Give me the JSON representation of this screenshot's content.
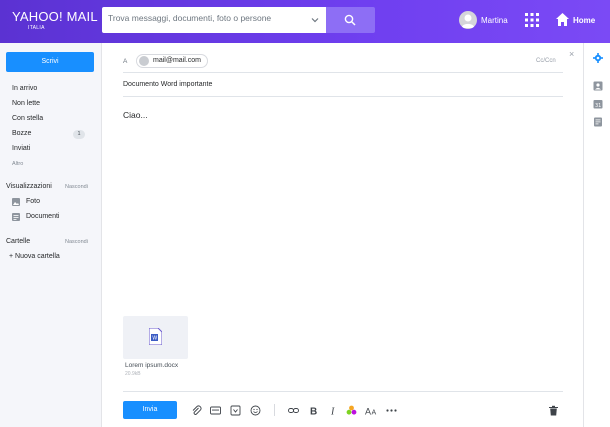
{
  "header": {
    "logo_main": "YAHOO! MAIL",
    "logo_sub": "ITALIA",
    "search_placeholder": "Trova messaggi, documenti, foto o persone",
    "user_name": "Martina",
    "home_label": "Home"
  },
  "sidebar": {
    "compose_label": "Scrivi",
    "items": [
      {
        "label": "In arrivo"
      },
      {
        "label": "Non lette"
      },
      {
        "label": "Con stella"
      },
      {
        "label": "Bozze",
        "badge": "1"
      },
      {
        "label": "Inviati"
      }
    ],
    "more_label": "Altro",
    "views": {
      "title": "Visualizzazioni",
      "action": "Nascondi",
      "items": [
        {
          "label": "Foto",
          "icon": "photo-icon"
        },
        {
          "label": "Documenti",
          "icon": "document-icon"
        }
      ]
    },
    "folders": {
      "title": "Cartelle",
      "action": "Nascondi",
      "new_folder": "+ Nuova cartella"
    }
  },
  "compose": {
    "to_label": "A",
    "recipient": "mail@mail.com",
    "cc_label": "Cc/Ccn",
    "close_label": "×",
    "subject": "Documento Word importante",
    "body": "Ciao...",
    "attachment": {
      "name": "Lorem ipsum.docx",
      "size": "20.9kB"
    },
    "send_label": "Invia"
  },
  "colors": {
    "header_gradient_start": "#5b32d2",
    "header_gradient_end": "#7b4af5",
    "primary_button": "#188fff",
    "sidebar_bg": "#f5f6fa"
  }
}
